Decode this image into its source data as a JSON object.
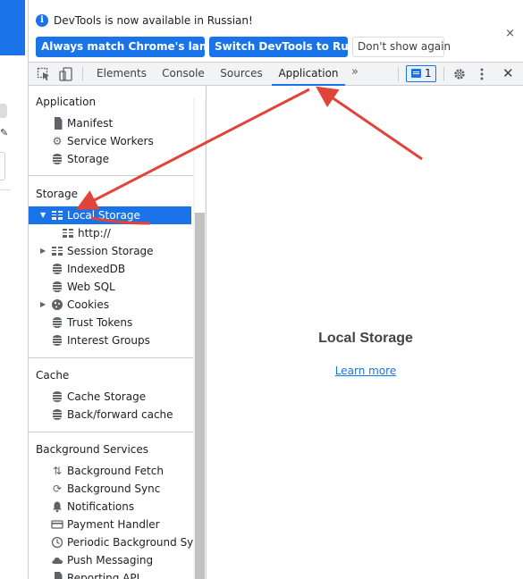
{
  "infobar": {
    "message": "DevTools is now available in Russian!",
    "info_icon": "i",
    "btn_match": "Always match Chrome's language",
    "btn_switch": "Switch DevTools to Russian",
    "btn_dont_show": "Don't show again",
    "close_glyph": "×"
  },
  "toolbar": {
    "tabs": [
      "Elements",
      "Console",
      "Sources",
      "Application"
    ],
    "active_tab": "Application",
    "more_glyph": "»",
    "issues_count": "1",
    "kebab_glyph": "⋮",
    "close_glyph": "✕"
  },
  "sidebar": {
    "sections": [
      {
        "title": "Application",
        "items": [
          {
            "label": "Manifest",
            "icon": "document-icon"
          },
          {
            "label": "Service Workers",
            "icon": "gear-icon"
          },
          {
            "label": "Storage",
            "icon": "database-icon"
          }
        ]
      },
      {
        "title": "Storage",
        "items": [
          {
            "label": "Local Storage",
            "icon": "grid-icon",
            "expanded": true,
            "selected": true
          },
          {
            "label": "http://",
            "icon": "grid-icon",
            "child": true
          },
          {
            "label": "Session Storage",
            "icon": "grid-icon",
            "collapsed": true
          },
          {
            "label": "IndexedDB",
            "icon": "database-icon"
          },
          {
            "label": "Web SQL",
            "icon": "database-icon"
          },
          {
            "label": "Cookies",
            "icon": "cookie-icon",
            "collapsed": true
          },
          {
            "label": "Trust Tokens",
            "icon": "database-icon"
          },
          {
            "label": "Interest Groups",
            "icon": "database-icon"
          }
        ]
      },
      {
        "title": "Cache",
        "items": [
          {
            "label": "Cache Storage",
            "icon": "database-icon"
          },
          {
            "label": "Back/forward cache",
            "icon": "database-icon"
          }
        ]
      },
      {
        "title": "Background Services",
        "items": [
          {
            "label": "Background Fetch",
            "icon": "up-down-arrows-icon"
          },
          {
            "label": "Background Sync",
            "icon": "sync-icon"
          },
          {
            "label": "Notifications",
            "icon": "bell-icon"
          },
          {
            "label": "Payment Handler",
            "icon": "card-icon"
          },
          {
            "label": "Periodic Background Sync",
            "icon": "clock-icon"
          },
          {
            "label": "Push Messaging",
            "icon": "cloud-icon"
          },
          {
            "label": "Reporting API",
            "icon": "document-icon"
          }
        ]
      }
    ]
  },
  "main": {
    "title": "Local Storage",
    "learn_more": "Learn more"
  },
  "colors": {
    "accent": "#1a73e8",
    "annotation_arrow": "#e0443a"
  }
}
